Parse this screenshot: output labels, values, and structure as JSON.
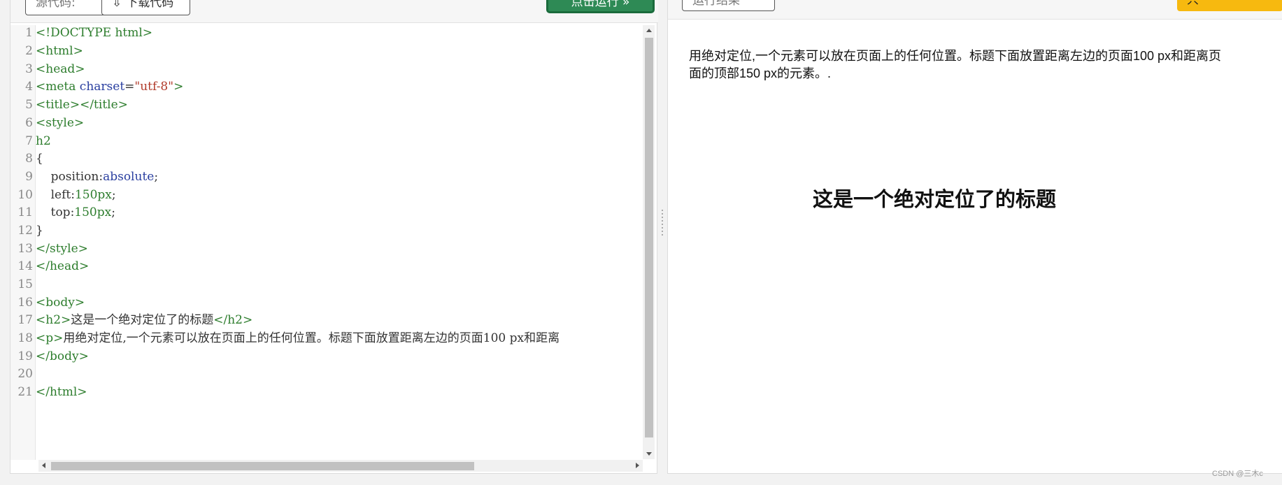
{
  "editor": {
    "toolbar": {
      "source_button": "源代码:",
      "download_button": "下载代码",
      "run_button": "点击运行 »"
    },
    "line_numbers": [
      "1",
      "2",
      "3",
      "4",
      "5",
      "6",
      "7",
      "8",
      "9",
      "10",
      "11",
      "12",
      "13",
      "14",
      "15",
      "16",
      "17",
      "18",
      "19",
      "20",
      "21"
    ],
    "code": {
      "l1": "<!DOCTYPE html>",
      "l2": "<html>",
      "l3": "<head>",
      "l4_tag_open": "<meta ",
      "l4_attr": "charset",
      "l4_eq": "=",
      "l4_str": "\"utf-8\"",
      "l4_close": ">",
      "l5": "<title></title>",
      "l6": "<style>",
      "l7": "h2",
      "l8": "{",
      "l9_prop": "    position:",
      "l9_val": "absolute",
      "l9_end": ";",
      "l10_prop": "    left:",
      "l10_val": "150px",
      "l10_end": ";",
      "l11_prop": "    top:",
      "l11_val": "150px",
      "l11_end": ";",
      "l12": "}",
      "l13": "</style>",
      "l14": "</head>",
      "l15": "",
      "l16": "<body>",
      "l17_open": "<h2>",
      "l17_text": "这是一个绝对定位了的标题",
      "l17_close": "</h2>",
      "l18_open": "<p>",
      "l18_text": "用绝对定位,一个元素可以放在页面上的任何位置。标题下面放置距离左边的页面100 px和距离",
      "l19": "</body>",
      "l20": "",
      "l21": "</html>"
    }
  },
  "preview": {
    "toolbar": {
      "result_button": "运行结果",
      "action_button": "只"
    },
    "paragraph_line1": "用绝对定位,一个元素可以放在页面上的任何位置。标题下面放置距离左边的页面100 px和距离页",
    "paragraph_line2": "面的顶部150 px的元素。.",
    "heading": "这是一个绝对定位了的标题"
  },
  "watermark": "CSDN @三木c",
  "colors": {
    "run_button": "#2e8a55",
    "action_button": "#f7b90f",
    "tag": "#2d7d2d",
    "attr": "#2a3fa0",
    "string": "#b13a2a"
  }
}
